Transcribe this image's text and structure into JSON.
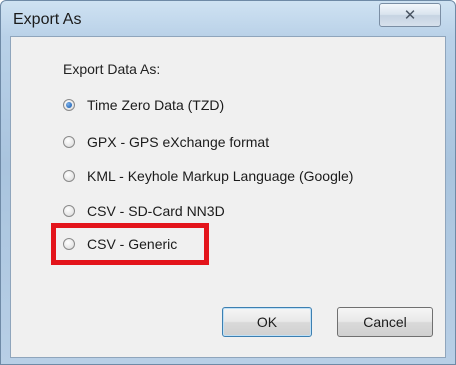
{
  "window": {
    "title": "Export As",
    "close_glyph": "✕"
  },
  "section_label": "Export Data As:",
  "options": [
    {
      "label": "Time Zero Data (TZD)",
      "selected": true
    },
    {
      "label": "GPX - GPS eXchange format",
      "selected": false
    },
    {
      "label": "KML - Keyhole Markup Language (Google)",
      "selected": false
    },
    {
      "label": "CSV - SD-Card NN3D",
      "selected": false
    },
    {
      "label": "CSV - Generic",
      "selected": false
    }
  ],
  "buttons": {
    "ok": "OK",
    "cancel": "Cancel"
  },
  "colors": {
    "highlight": "#e3141b",
    "radio_selected": "#2c6fbf"
  }
}
